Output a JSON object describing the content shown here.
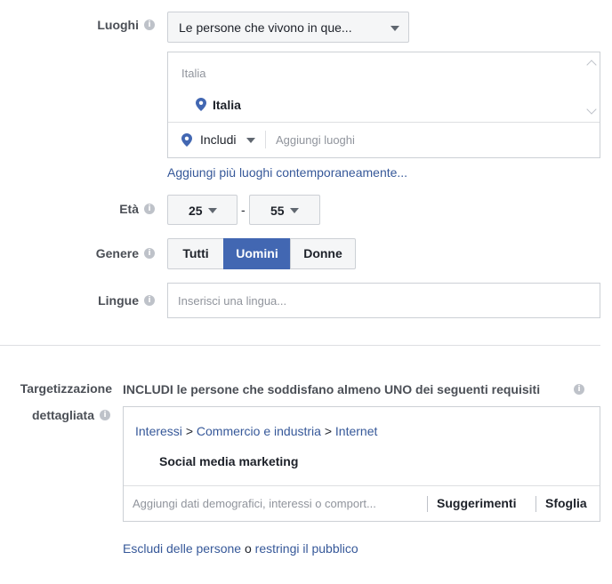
{
  "locations": {
    "label": "Luoghi",
    "mode_value": "Le persone che vivono in que...",
    "group_header": "Italia",
    "selected_location": "Italia",
    "include_value": "Includi",
    "add_placeholder": "Aggiungi luoghi",
    "bulk_link": "Aggiungi più luoghi contemporaneamente..."
  },
  "age": {
    "label": "Età",
    "min": "25",
    "separator": "-",
    "max": "55"
  },
  "gender": {
    "label": "Genere",
    "options": [
      "Tutti",
      "Uomini",
      "Donne"
    ],
    "selected": "Uomini"
  },
  "languages": {
    "label": "Lingue",
    "placeholder": "Inserisci una lingua..."
  },
  "detailed_targeting": {
    "label_line1": "Targetizzazione",
    "label_line2": "dettagliata",
    "description": "INCLUDI le persone che soddisfano almeno UNO dei seguenti requisiti",
    "path": [
      "Interessi",
      "Commercio e industria",
      "Internet"
    ],
    "path_sep": ">",
    "selected_item": "Social media marketing",
    "search_placeholder": "Aggiungi dati demografici, interessi o comport...",
    "suggestions_label": "Suggerimenti",
    "browse_label": "Sfoglia",
    "exclude_link": "Escludi delle persone",
    "or_text": "o",
    "narrow_link": "restringi il pubblico"
  },
  "info_glyph": "i",
  "colors": {
    "accent": "#4267b2",
    "link": "#365899",
    "border": "#ccd0d5",
    "pin": "#4267b2"
  }
}
